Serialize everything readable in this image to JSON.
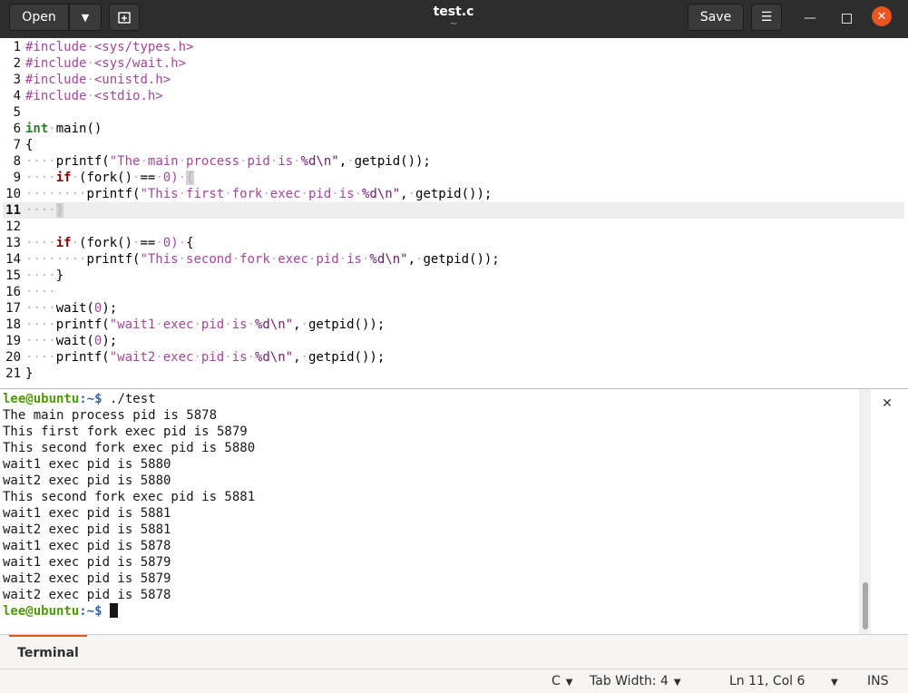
{
  "header": {
    "open_label": "Open",
    "title": "test.c",
    "subtitle": "~",
    "save_label": "Save"
  },
  "editor": {
    "lines": [
      {
        "n": "1"
      },
      {
        "n": "2"
      },
      {
        "n": "3"
      },
      {
        "n": "4"
      },
      {
        "n": "5"
      },
      {
        "n": "6"
      },
      {
        "n": "7"
      },
      {
        "n": "8"
      },
      {
        "n": "9"
      },
      {
        "n": "10"
      },
      {
        "n": "11"
      },
      {
        "n": "12"
      },
      {
        "n": "13"
      },
      {
        "n": "14"
      },
      {
        "n": "15"
      },
      {
        "n": "16"
      },
      {
        "n": "17"
      },
      {
        "n": "18"
      },
      {
        "n": "19"
      },
      {
        "n": "20"
      },
      {
        "n": "21"
      }
    ],
    "text": {
      "l1": {
        "a": "#include",
        "b": "<sys/types.h>"
      },
      "l2": {
        "a": "#include",
        "b": "<sys/wait.h>"
      },
      "l3": {
        "a": "#include",
        "b": "<unistd.h>"
      },
      "l4": {
        "a": "#include",
        "b": "<stdio.h>"
      },
      "l6": {
        "a": "int",
        "b": "main()"
      },
      "l7": {
        "a": "{"
      },
      "l8": {
        "a": "printf(",
        "b": "\"The",
        "c": "main",
        "d": "process",
        "e": "pid",
        "f": "is",
        "g": "%d",
        "h": "\\n\"",
        "i": ",",
        "j": "getpid());"
      },
      "l9": {
        "a": "if",
        "b": "(fork()",
        "c": "==",
        "d": "0)",
        "e": "{"
      },
      "l10": {
        "a": "printf(",
        "b": "\"This",
        "c": "first",
        "d": "fork",
        "e": "exec",
        "f": "pid",
        "g": "is",
        "h": "%d",
        "i": "\\n\"",
        "j": ",",
        "k": "getpid());"
      },
      "l11": {
        "a": "}"
      },
      "l13": {
        "a": "if",
        "b": "(fork()",
        "c": "==",
        "d": "0)",
        "e": "{"
      },
      "l14": {
        "a": "printf(",
        "b": "\"This",
        "c": "second",
        "d": "fork",
        "e": "exec",
        "f": "pid",
        "g": "is",
        "h": "%d",
        "i": "\\n\"",
        "j": ",",
        "k": "getpid());"
      },
      "l15": {
        "a": "}"
      },
      "l17": {
        "a": "wait(",
        "b": "0",
        "c": ");"
      },
      "l18": {
        "a": "printf(",
        "b": "\"wait1",
        "c": "exec",
        "d": "pid",
        "e": "is",
        "f": "%d",
        "g": "\\n\"",
        "h": ",",
        "i": "getpid());"
      },
      "l19": {
        "a": "wait(",
        "b": "0",
        "c": ");"
      },
      "l20": {
        "a": "printf(",
        "b": "\"wait2",
        "c": "exec",
        "d": "pid",
        "e": "is",
        "f": "%d",
        "g": "\\n\"",
        "h": ",",
        "i": "getpid());"
      },
      "l21": {
        "a": "}"
      }
    }
  },
  "terminal": {
    "prompt_user": "lee@ubuntu",
    "prompt_path": ":~$",
    "command": " ./test",
    "output": [
      "The main process pid is 5878",
      "This first fork exec pid is 5879",
      "This second fork exec pid is 5880",
      "wait1 exec pid is 5880",
      "wait2 exec pid is 5880",
      "This second fork exec pid is 5881",
      "wait1 exec pid is 5881",
      "wait2 exec pid is 5881",
      "wait1 exec pid is 5878",
      "wait1 exec pid is 5879",
      "wait2 exec pid is 5879",
      "wait2 exec pid is 5878"
    ]
  },
  "panel": {
    "tab_label": "Terminal"
  },
  "statusbar": {
    "language": "C",
    "tab_width": "Tab Width: 4",
    "position": "Ln 11, Col 6",
    "mode": "INS"
  }
}
